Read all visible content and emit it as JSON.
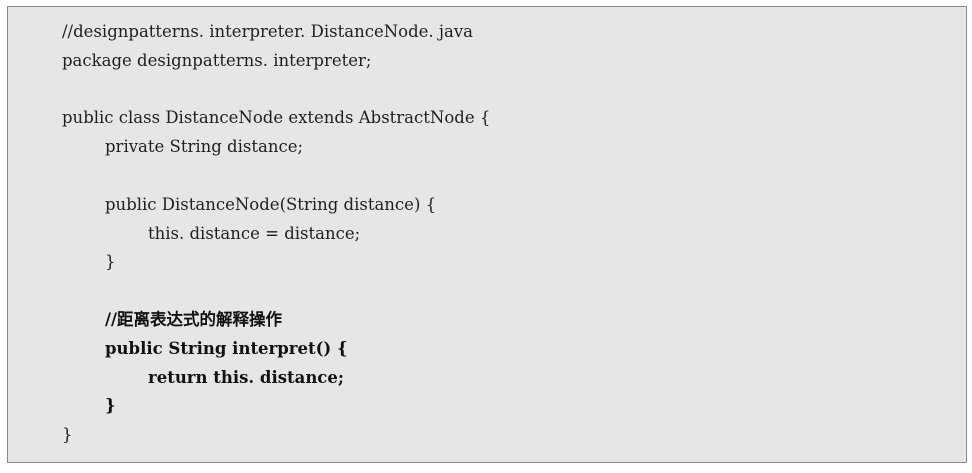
{
  "code": {
    "lines": [
      "//designpatterns. interpreter. DistanceNode. java",
      "package designpatterns. interpreter;",
      "",
      "public class DistanceNode extends AbstractNode {",
      "private String distance;",
      "",
      "public DistanceNode(String distance) {",
      "this. distance = distance;",
      "}",
      "",
      "//距离表达式的解释操作",
      "public String interpret() {",
      "return this. distance;",
      "}",
      "}"
    ]
  }
}
